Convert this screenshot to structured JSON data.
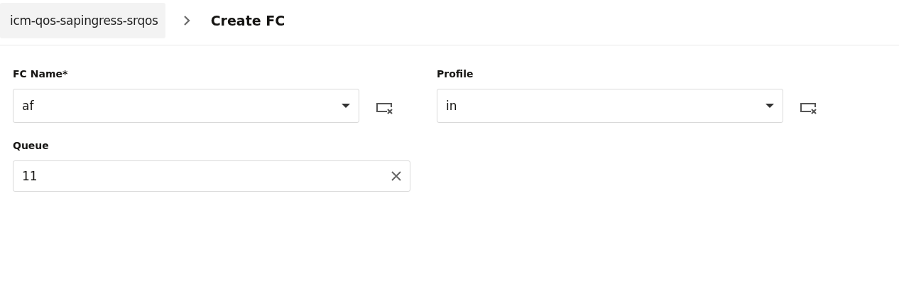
{
  "breadcrumb": {
    "parent": "icm-qos-sapingress-srqos",
    "current": "Create FC"
  },
  "fields": [
    {
      "kind": "select",
      "label": "FC Name*",
      "value": "af"
    },
    {
      "kind": "select",
      "label": "Profile",
      "value": "in"
    },
    {
      "kind": "text",
      "label": "Queue",
      "value": "11"
    }
  ]
}
